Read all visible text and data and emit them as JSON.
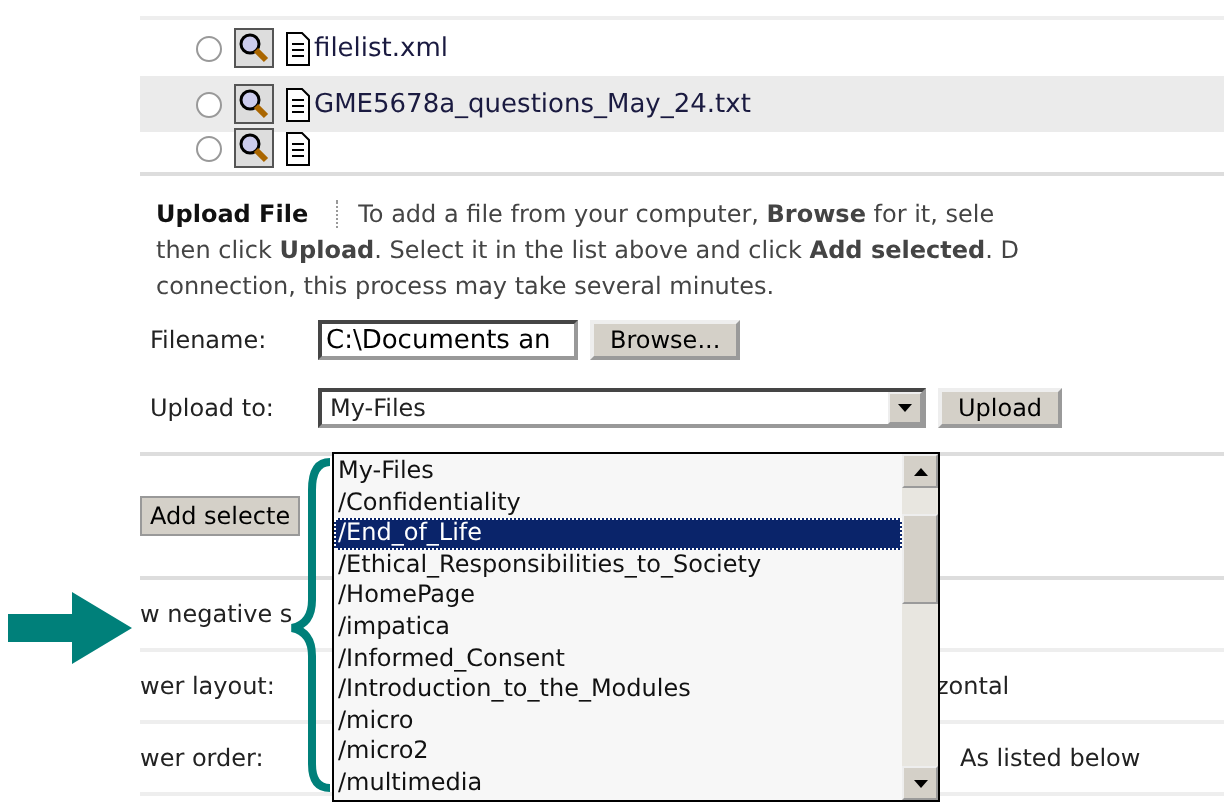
{
  "files": [
    {
      "name": "filelist.xml",
      "selected": false
    },
    {
      "name": "GME5678a_questions_May_24.txt",
      "selected": false
    },
    {
      "selected": false
    }
  ],
  "upload": {
    "title": "Upload File",
    "instructions": [
      "To add a file from your computer, **Browse** for it, sele",
      "then click **Upload**. Select it in the list above and click **Add selected**. D",
      "connection, this process may take several minutes."
    ],
    "filename_label": "Filename:",
    "filename_value": "C:\\Documents an",
    "browse_button": "Browse...",
    "upload_to_label": "Upload to:",
    "upload_to_value": "My-Files",
    "upload_button": "Upload"
  },
  "dropdown_options": [
    {
      "label": "My-Files",
      "selected": false
    },
    {
      "label": "/Confidentiality",
      "selected": false
    },
    {
      "label": "/End_of_Life",
      "selected": true
    },
    {
      "label": "/Ethical_Responsibilities_to_Society",
      "selected": false
    },
    {
      "label": "/HomePage",
      "selected": false
    },
    {
      "label": "/impatica",
      "selected": false
    },
    {
      "label": "/Informed_Consent",
      "selected": false
    },
    {
      "label": "/Introduction_to_the_Modules",
      "selected": false
    },
    {
      "label": "/micro",
      "selected": false
    },
    {
      "label": "/micro2",
      "selected": false
    },
    {
      "label": "/multimedia",
      "selected": false
    }
  ],
  "add_selected_button": "Add selecte",
  "settings": [
    {
      "label": "w negative s"
    },
    {
      "label": "wer layout:",
      "value": "zontal"
    },
    {
      "label": "wer order:",
      "value": "As listed below"
    }
  ]
}
